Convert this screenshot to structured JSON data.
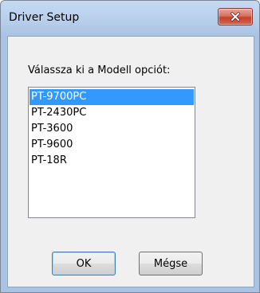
{
  "window": {
    "title": "Driver Setup"
  },
  "icons": {
    "close": "close-icon"
  },
  "colors": {
    "selection": "#3399ff",
    "close_button": "#c3412d",
    "frame": "#aac3e3"
  },
  "dialog": {
    "prompt": "Válassza ki a Modell opciót:",
    "models": [
      "PT-9700PC",
      "PT-2430PC",
      "PT-3600",
      "PT-9600",
      "PT-18R"
    ],
    "selected": "PT-9700PC",
    "ok_label": "OK",
    "cancel_label": "Mégse"
  }
}
